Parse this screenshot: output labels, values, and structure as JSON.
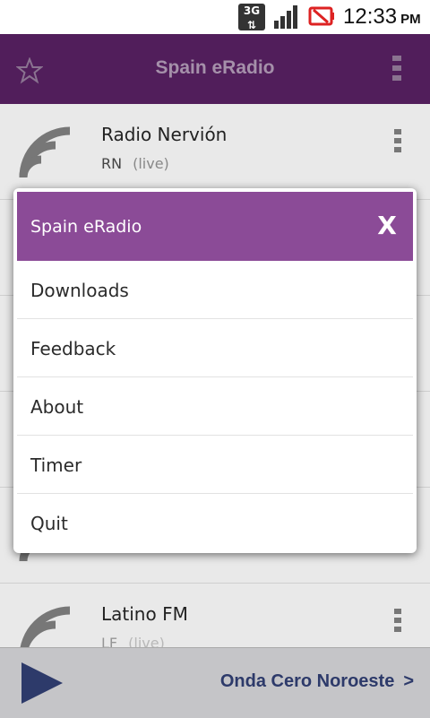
{
  "status_bar": {
    "network": "3G",
    "time": "12:33",
    "ampm": "PM"
  },
  "action_bar": {
    "title": "Spain eRadio",
    "star_icon": "star-outline-icon",
    "menu_icon": "overflow-menu-icon"
  },
  "stations": [
    {
      "name": "Radio Nervión",
      "code": "RN",
      "status": "(live)"
    },
    {
      "name": "",
      "code": "",
      "status": ""
    },
    {
      "name": "",
      "code": "",
      "status": ""
    },
    {
      "name": "",
      "code": "",
      "status": ""
    },
    {
      "name": "",
      "code": "",
      "status": ""
    },
    {
      "name": "Latino FM",
      "code": "LF",
      "status": "(live)"
    }
  ],
  "player": {
    "station": "Onda Cero Noroeste",
    "arrow": ">"
  },
  "dialog": {
    "title": "Spain eRadio",
    "close_label": "X",
    "items": [
      "Downloads",
      "Feedback",
      "About",
      "Timer",
      "Quit"
    ]
  },
  "colors": {
    "action_bar": "#511e5b",
    "dialog_header": "#8b4b97",
    "player_text": "#2d3a6a"
  }
}
